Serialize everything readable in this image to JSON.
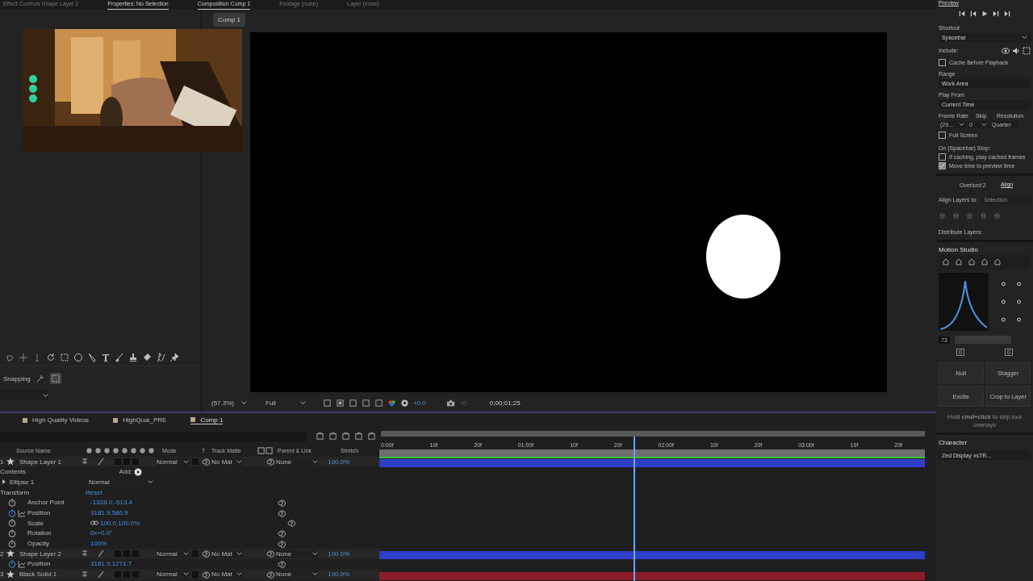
{
  "top_tabs": [
    {
      "label": "Effect Controls Shape Layer 2",
      "selected": false
    },
    {
      "label": "Properties: No Selection",
      "selected": true
    },
    {
      "label": "Composition Comp 1",
      "selected": true
    },
    {
      "label": "Footage (none)",
      "selected": false
    },
    {
      "label": "Layer (none)",
      "selected": false
    }
  ],
  "tools": {
    "snapping_label": "Snapping"
  },
  "viewer": {
    "breadcrumb": "Comp 1",
    "zoom": "(57.3%)",
    "resolution": "Full",
    "exposure": "+0.0",
    "timecode": "0;00;01;25"
  },
  "preview": {
    "title": "Preview",
    "shortcut_label": "Shortcut",
    "shortcut": "Spacebar",
    "include_label": "Include:",
    "cache": {
      "label": "Cache Before Playback",
      "checked": false
    },
    "range_label": "Range",
    "range": "Work Area",
    "play_from_label": "Play From",
    "play_from": "Current Time",
    "frame_rate_label": "Frame Rate",
    "skip_label": "Skip",
    "resolution_label": "Resolution",
    "frame_rate": "(29...",
    "skip": "0",
    "resolution": "Quarter",
    "full_screen": {
      "label": "Full Screen",
      "checked": false
    },
    "stop_label": "On (Spacebar) Stop:",
    "stop_options": [
      {
        "label": "If caching, play cached frames",
        "checked": false
      },
      {
        "label": "Move time to preview time",
        "checked": true
      }
    ]
  },
  "align": {
    "tabs": [
      {
        "label": "Overlord 2",
        "selected": false
      },
      {
        "label": "Align",
        "selected": true
      }
    ],
    "align_to_label": "Align Layers to:",
    "align_to": {
      "value": "Selection",
      "disabled": true
    },
    "distribute_label": "Distribute Layers:"
  },
  "motion_studio": {
    "title": "Motion Studio",
    "frame_count": "73",
    "slider_values": [
      "0",
      "0"
    ],
    "tools": [
      {
        "label": "Null"
      },
      {
        "label": "Stagger"
      },
      {
        "label": "Excite"
      },
      {
        "label": "Crop to Layer"
      }
    ],
    "hint": "Hold **cmd+click** to skip tool overlays"
  },
  "character": {
    "title": "Character",
    "font": "Zed Display xsTR..."
  },
  "timeline": {
    "tabs": [
      {
        "label": "High Quality Videos",
        "selected": false
      },
      {
        "label": "HighQual_PRE",
        "selected": false
      },
      {
        "label": "Comp 1",
        "selected": true
      }
    ],
    "columns": [
      "Source Name",
      "Mode",
      "T",
      "Track Matte",
      "Parent & Link",
      "Stretch"
    ],
    "ruler": [
      "0:00f",
      "10f",
      "20f",
      "01:00f",
      "10f",
      "20f",
      "02:00f",
      "10f",
      "20f",
      "03:00f",
      "10f",
      "20f"
    ],
    "playhead": {
      "level": 0.466
    },
    "rows": [
      {
        "kind": "layer",
        "number": "1",
        "name": "Shape Layer 1",
        "mode": "Normal",
        "matte": "No Mat",
        "parent": "None",
        "stretch": "100.0%",
        "color": "#2f3fc8",
        "preserve_transparency": false
      },
      {
        "kind": "add-group",
        "name": "Contents",
        "add_label": "Add:"
      },
      {
        "kind": "dropdown-group",
        "name": "Ellipse 1",
        "action": "Normal"
      },
      {
        "kind": "link-group",
        "name": "Transform",
        "action": "Reset"
      },
      {
        "kind": "property",
        "name": "Anchor Point",
        "value": "-1328.0,-513.4",
        "animated": false
      },
      {
        "kind": "property",
        "name": "Position",
        "value": "3181.9,580.9",
        "animated": true
      },
      {
        "kind": "property",
        "name": "Scale",
        "value": "100.0,100.0%",
        "animated": false,
        "linked": true
      },
      {
        "kind": "property",
        "name": "Rotation",
        "value": "0x+0.0°",
        "animated": false
      },
      {
        "kind": "property",
        "name": "Opacity",
        "value": "100%",
        "animated": false
      },
      {
        "kind": "layer",
        "number": "2",
        "name": "Shape Layer 2",
        "mode": "Normal",
        "matte": "No Mat",
        "parent": "None",
        "stretch": "100.0%",
        "color": "#2f3fc8",
        "preserve_transparency": false
      },
      {
        "kind": "property",
        "name": "Position",
        "value": "3181.9,1271.7",
        "animated": true
      },
      {
        "kind": "layer",
        "number": "3",
        "name": "Black Solid 1",
        "mode": "Normal",
        "matte": "No Mat",
        "parent": "None",
        "stretch": "100.0%",
        "color": "#8c1c28",
        "preserve_transparency": false
      }
    ]
  }
}
